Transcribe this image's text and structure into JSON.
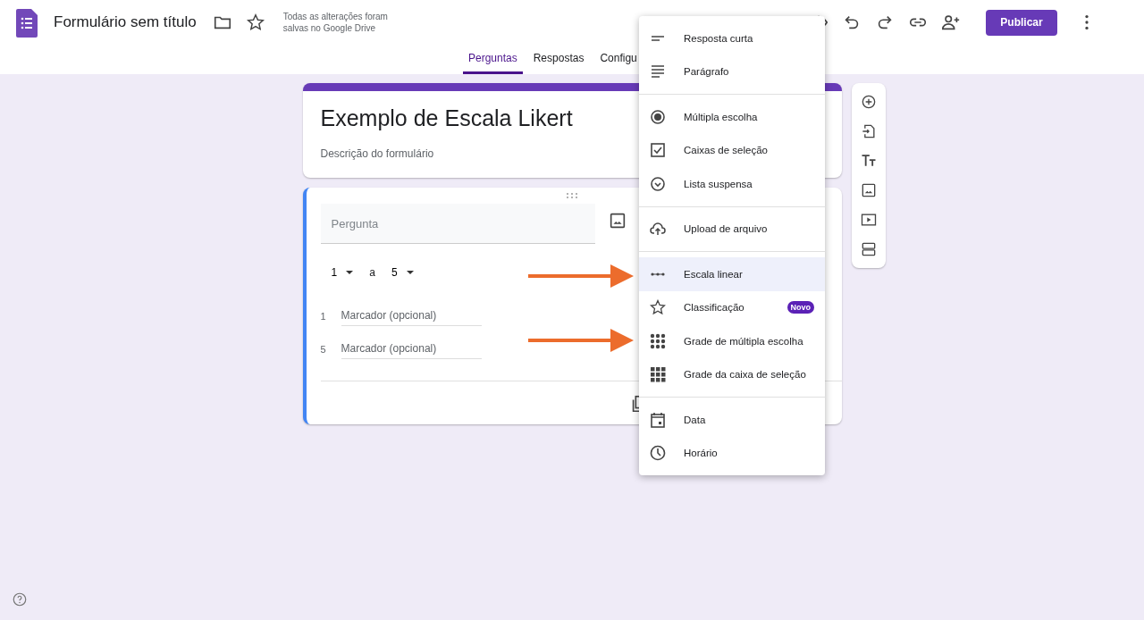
{
  "header": {
    "title": "Formulário sem título",
    "save_status": [
      "Todas as alterações foram",
      "salvas no Google Drive"
    ],
    "publish_button": "Publicar"
  },
  "tabs": [
    {
      "label": "Perguntas",
      "selected": true
    },
    {
      "label": "Respostas",
      "selected": false
    },
    {
      "label": "Configu",
      "selected": false
    }
  ],
  "form": {
    "title": "Exemplo de Escala Likert",
    "description": "Descrição do formulário"
  },
  "question": {
    "placeholder": "Pergunta",
    "scale_from": "1",
    "scale_separator": "a",
    "scale_to": "5",
    "labels": [
      {
        "value": "1",
        "placeholder": "Marcador (opcional)"
      },
      {
        "value": "5",
        "placeholder": "Marcador (opcional)"
      }
    ]
  },
  "type_menu": {
    "groups": [
      {
        "items": [
          {
            "label": "Resposta curta",
            "kind": "short",
            "selected": false
          },
          {
            "label": "Parágrafo",
            "kind": "paragraph",
            "selected": false
          }
        ]
      },
      {
        "items": [
          {
            "label": "Múltipla escolha",
            "kind": "radio",
            "selected": false
          },
          {
            "label": "Caixas de seleção",
            "kind": "checkbox",
            "selected": false
          },
          {
            "label": "Lista suspensa",
            "kind": "dropdown",
            "selected": false
          }
        ]
      },
      {
        "items": [
          {
            "label": "Upload de arquivo",
            "kind": "upload",
            "selected": false
          }
        ]
      },
      {
        "items": [
          {
            "label": "Escala linear",
            "kind": "linear",
            "selected": true
          },
          {
            "label": "Classificação",
            "kind": "rating",
            "selected": false,
            "badge": "Novo"
          },
          {
            "label": "Grade de múltipla escolha",
            "kind": "grid_radio",
            "selected": false
          },
          {
            "label": "Grade da caixa de seleção",
            "kind": "grid_check",
            "selected": false
          }
        ]
      },
      {
        "items": [
          {
            "label": "Data",
            "kind": "date",
            "selected": false
          },
          {
            "label": "Horário",
            "kind": "time",
            "selected": false
          }
        ]
      }
    ]
  }
}
